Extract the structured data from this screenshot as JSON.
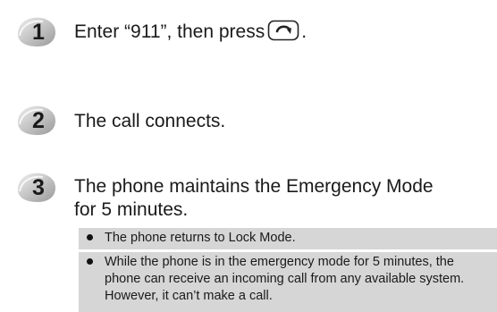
{
  "steps": [
    {
      "number": "1",
      "before": "Enter “911”, then press",
      "after": ".",
      "key_icon": "send-key-icon"
    },
    {
      "number": "2",
      "text": "The call connects."
    },
    {
      "number": "3",
      "line1": "The phone maintains the Emergency Mode",
      "line2": "for 5 minutes."
    }
  ],
  "notes": [
    "The phone returns to Lock Mode.",
    "While the phone is in the emergency mode for 5 minutes, the phone can receive an incoming call from any available system. However, it can’t make a call."
  ],
  "colors": {
    "badge_dark": "#5a5a5a",
    "badge_light": "#c8c8c8",
    "note_band": "#d6d6d6",
    "note_stripe": "#bdbdbd"
  }
}
